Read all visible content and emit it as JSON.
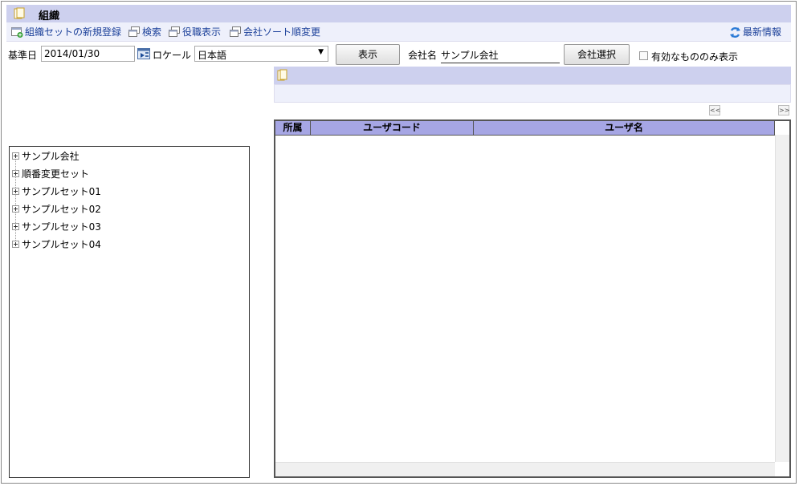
{
  "header": {
    "title": "組織",
    "icon": "folder-icon"
  },
  "toolbar": {
    "new_set": "組織セットの新規登録",
    "search": "検索",
    "post_display": "役職表示",
    "company_sort": "会社ソート順変更",
    "refresh": "最新情報"
  },
  "filters": {
    "base_date_label": "基準日",
    "base_date_value": "2014/01/30",
    "locale_label": "ロケール",
    "locale_value": "日本語",
    "show_button": "表示",
    "company_label": "会社名",
    "company_value": "サンプル会社",
    "company_select_button": "会社選択",
    "active_only_label": "有効なもののみ表示",
    "active_only_checked": false
  },
  "pager": {
    "prev": "<<",
    "next": ">>"
  },
  "tree": {
    "items": [
      {
        "label": "サンプル会社"
      },
      {
        "label": "順番変更セット"
      },
      {
        "label": "サンプルセット01"
      },
      {
        "label": "サンプルセット02"
      },
      {
        "label": "サンプルセット03"
      },
      {
        "label": "サンプルセット04"
      }
    ]
  },
  "grid": {
    "columns": [
      "所属",
      "ユーザコード",
      "ユーザ名"
    ],
    "rows": []
  },
  "colors": {
    "header_bg": "#cdd0ee",
    "toolbar_bg": "#eef0fb",
    "grid_header_bg": "#a6a6e4",
    "link": "#1a3f99"
  }
}
